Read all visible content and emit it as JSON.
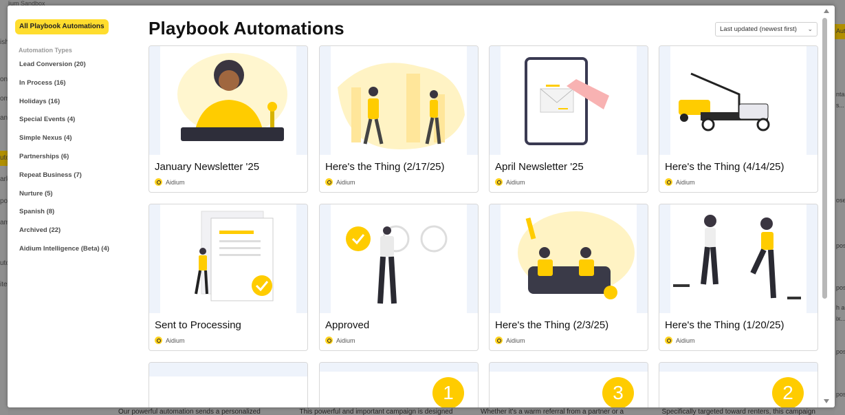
{
  "backdrop": {
    "left_fragments": [
      "ish",
      "ont",
      "om",
      "ans",
      "uto",
      "ark",
      "po",
      "am",
      "uto",
      "ite"
    ],
    "right_fragments": [
      "Auto",
      "ntai",
      "s...",
      "ose",
      "pos",
      "pos",
      "pos",
      "pos",
      "h a",
      "ix..."
    ],
    "bottom_fragments": [
      "Our powerful automation sends a personalized",
      "This powerful and important campaign is designed",
      "Whether it's a warm referral from a partner or a",
      "Specifically targeted toward renters, this campaign"
    ],
    "top_fragment": "Aidium Sandbox"
  },
  "sidebar": {
    "all_label": "All Playbook Automations",
    "types_heading": "Automation Types",
    "types": [
      "Lead Conversion (20)",
      "In Process (16)",
      "Holidays (16)",
      "Special Events (4)",
      "Simple Nexus (4)",
      "Partnerships (6)",
      "Repeat Business (7)",
      "Nurture (5)",
      "Spanish (8)",
      "Archived (22)",
      "Aidium Intelligence (Beta) (4)"
    ]
  },
  "main": {
    "title": "Playbook Automations",
    "sort_label": "Last updated (newest first)"
  },
  "cards": [
    {
      "title": "January Newsletter '25",
      "author": "Aidium",
      "image": "person-at-desk-illustration"
    },
    {
      "title": "Here's the Thing (2/17/25)",
      "author": "Aidium",
      "image": "people-walking-city-illustration"
    },
    {
      "title": "April Newsletter '25",
      "author": "Aidium",
      "image": "tablet-envelope-illustration"
    },
    {
      "title": "Here's the Thing (4/14/25)",
      "author": "Aidium",
      "image": "tow-truck-illustration"
    },
    {
      "title": "Sent to Processing",
      "author": "Aidium",
      "image": "documents-checkmark-illustration"
    },
    {
      "title": "Approved",
      "author": "Aidium",
      "image": "woman-checkmark-circles-illustration"
    },
    {
      "title": "Here's the Thing (2/3/25)",
      "author": "Aidium",
      "image": "sports-fans-couch-illustration"
    },
    {
      "title": "Here's the Thing (1/20/25)",
      "author": "Aidium",
      "image": "workout-women-illustration"
    }
  ],
  "partial_cards": [
    {
      "badge": ""
    },
    {
      "badge": "1"
    },
    {
      "badge": "3"
    },
    {
      "badge": "2"
    }
  ],
  "colors": {
    "accent": "#ffdd2e",
    "illustration_yellow": "#ffcc00",
    "thumb_bg": "#eef3fb"
  }
}
